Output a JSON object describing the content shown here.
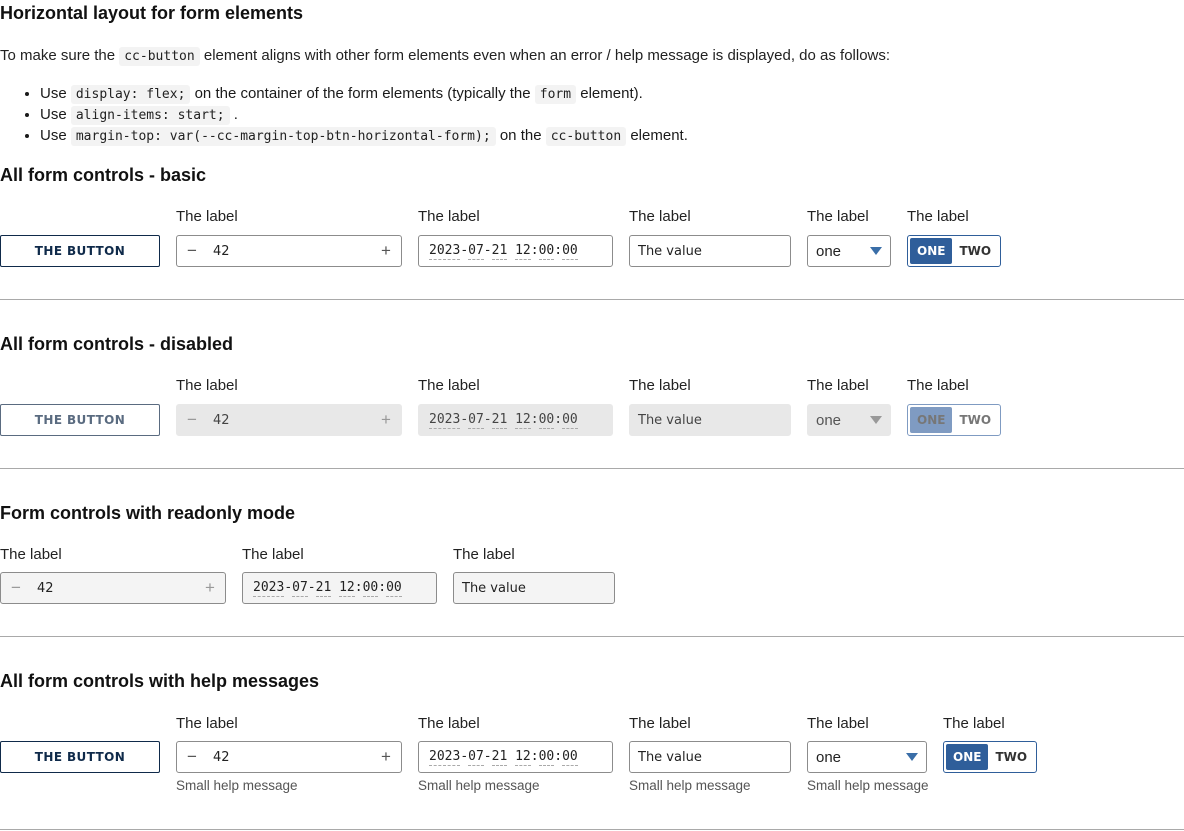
{
  "intro": {
    "title": "Horizontal layout for form elements",
    "para_before": "To make sure the ",
    "para_code": "cc-button",
    "para_after": " element aligns with other form elements even when an error / help message is displayed, do as follows:",
    "bullets": [
      {
        "pre": "Use ",
        "code": "display: flex;",
        "post": " on the container of the form elements (typically the ",
        "code2": "form",
        "post2": " element)."
      },
      {
        "pre": "Use ",
        "code": "align-items: start;",
        "post": " ."
      },
      {
        "pre": "Use ",
        "code": "margin-top: var(--cc-margin-top-btn-horizontal-form);",
        "post": " on the ",
        "code2": "cc-button",
        "post2": " element."
      }
    ]
  },
  "common": {
    "label": "The label",
    "button_label": "THE BUTTON",
    "number_value": "42",
    "minus": "−",
    "plus": "+",
    "date": {
      "y": "2023",
      "m": "07",
      "d": "21",
      "h": "12",
      "mi": "00",
      "s": "00"
    },
    "text_value": "The value",
    "select_value": "one",
    "toggle": [
      "ONE",
      "TWO"
    ],
    "help": "Small help message"
  },
  "sections": {
    "basic": "All form controls - basic",
    "disabled": "All form controls - disabled",
    "readonly": "Form controls with readonly mode",
    "help": "All form controls with help messages"
  },
  "colors": {
    "accent": "#2f5e9a",
    "button_text": "#0f2a4a"
  }
}
